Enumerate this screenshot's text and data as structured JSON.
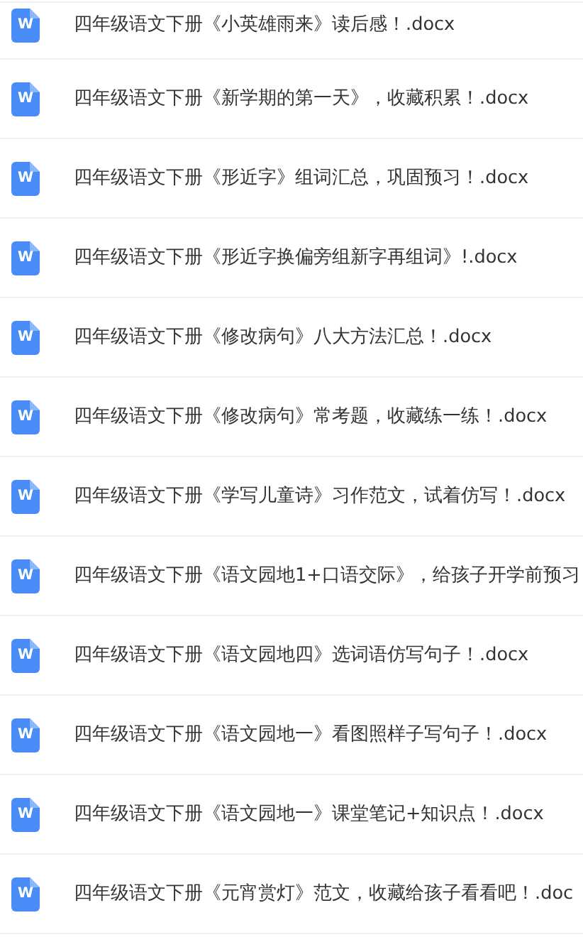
{
  "files": [
    {
      "icon_label": "W",
      "name": "四年级语文下册《小英雄雨来》读后感！.docx"
    },
    {
      "icon_label": "W",
      "name": "四年级语文下册《新学期的第一天》，收藏积累！.docx"
    },
    {
      "icon_label": "W",
      "name": "四年级语文下册《形近字》组词汇总，巩固预习！.docx"
    },
    {
      "icon_label": "W",
      "name": "四年级语文下册《形近字换偏旁组新字再组词》!.docx"
    },
    {
      "icon_label": "W",
      "name": "四年级语文下册《修改病句》八大方法汇总！.docx"
    },
    {
      "icon_label": "W",
      "name": "四年级语文下册《修改病句》常考题，收藏练一练！.docx"
    },
    {
      "icon_label": "W",
      "name": "四年级语文下册《学写儿童诗》习作范文，试着仿写！.docx"
    },
    {
      "icon_label": "W",
      "name": "四年级语文下册《语文园地1+口语交际》，给孩子开学前预习"
    },
    {
      "icon_label": "W",
      "name": "四年级语文下册《语文园地四》选词语仿写句子！.docx"
    },
    {
      "icon_label": "W",
      "name": "四年级语文下册《语文园地一》看图照样子写句子！.docx"
    },
    {
      "icon_label": "W",
      "name": "四年级语文下册《语文园地一》课堂笔记+知识点！.docx"
    },
    {
      "icon_label": "W",
      "name": "四年级语文下册《元宵赏灯》范文，收藏给孩子看看吧！.doc"
    }
  ]
}
